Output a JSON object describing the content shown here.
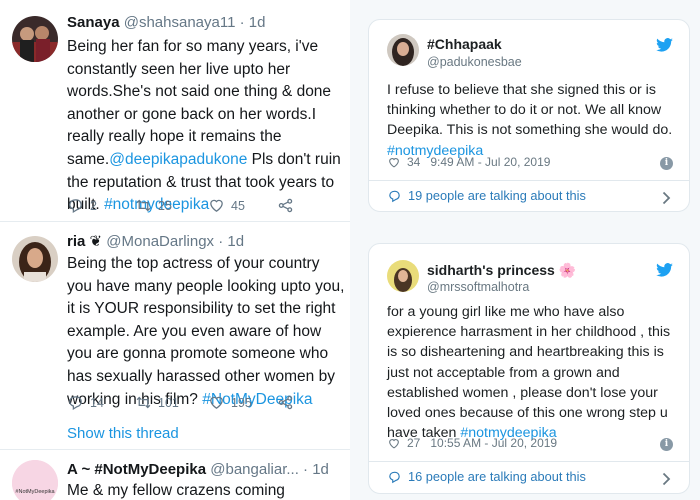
{
  "timeline": {
    "tweets": [
      {
        "name": "Sanaya",
        "handle": "@shahsanaya11",
        "time": "· 1d",
        "text_plain": "Being her fan for so many years, i've constantly seen her live upto her words.She's not said one thing & done another or gone back on her words.I really really hope it remains the same.",
        "mention": "@deepikapadukone",
        "text_after_mention": " Pls don't ruin the reputation & trust that took years to built. ",
        "hashtag": "#notmydeepika",
        "replies": "2",
        "retweets": "25",
        "likes": "45"
      },
      {
        "name": "ria",
        "badge": "❦",
        "handle": "@MonaDarlingx",
        "time": "· 1d",
        "text_plain": "Being the top actress of your country you have many people looking upto you, it is YOUR responsibility to set the right example. Are you even aware of how you are gonna promote someone who has sexually harassed other women by working in his film? ",
        "hashtag": "#NotMyDeepika",
        "replies": "14",
        "retweets": "101",
        "likes": "195",
        "show_thread": "Show this thread"
      },
      {
        "name": "A ~ #NotMyDeepika",
        "handle": "@bangaliar...",
        "time": "· 1d",
        "text_plain": "Me & my fellow crazens coming together",
        "avatar_text": "#NotMyDeepika"
      }
    ]
  },
  "cards": [
    {
      "name": "#Chhapaak",
      "handle": "@padukonesbae",
      "text_plain": "I refuse to believe that she signed this or is thinking whether to do it or not. We all know Deepika. This is not something she would do. ",
      "hashtag": "#notmydeepika",
      "likes": "34",
      "timestamp": "9:49 AM - Jul 20, 2019",
      "talking": "19 people are talking about this"
    },
    {
      "name": "sidharth's princess",
      "emoji": "🌸",
      "handle": "@mrssoftmalhotra",
      "text_plain": "for a young girl like me who have also expierence harrasment in her childhood , this is so disheartening and heartbreaking this is just not acceptable from a grown and established women , please don't lose your loved ones because of this one wrong step u have taken ",
      "hashtag": "#notmydeepika",
      "likes": "27",
      "timestamp": "10:55 AM - Jul 20, 2019",
      "talking": "16 people are talking about this"
    }
  ],
  "colors": {
    "link": "#1b95e0",
    "muted": "#657786",
    "twitter_blue": "#1da1f2",
    "panel_bg": "#f5f8fa"
  }
}
